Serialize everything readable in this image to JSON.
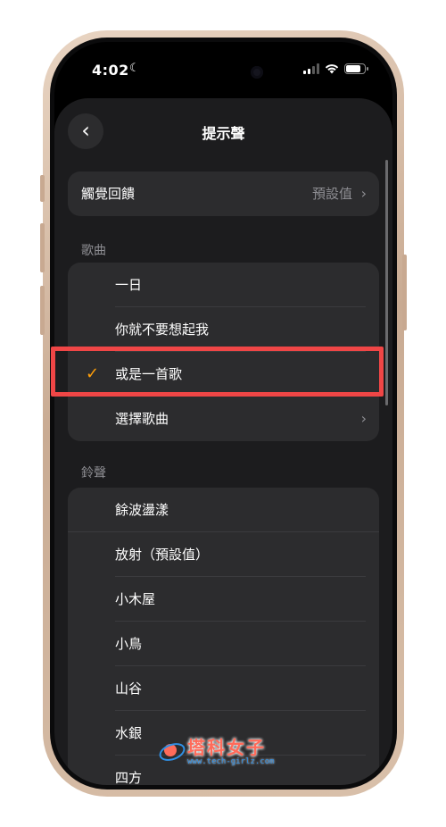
{
  "status": {
    "time": "4:02",
    "moon": "☾"
  },
  "header": {
    "back_icon": "‹",
    "title": "提示聲"
  },
  "haptics": {
    "label": "觸覺回饋",
    "value": "預設值",
    "chevron": "›"
  },
  "songs": {
    "section_label": "歌曲",
    "items": [
      {
        "label": "一日",
        "selected": false
      },
      {
        "label": "你就不要想起我",
        "selected": false
      },
      {
        "label": "或是一首歌",
        "selected": true
      },
      {
        "label": "選擇歌曲",
        "selected": false
      }
    ],
    "check": "✓",
    "chevron": "›"
  },
  "ringtones": {
    "section_label": "鈴聲",
    "items": [
      "餘波盪漾",
      "放射（預設值）",
      "小木屋",
      "小鳥",
      "山谷",
      "水銀",
      "四方"
    ]
  },
  "watermark": {
    "main": "塔科女子",
    "sub": "www.tech-girlz.com"
  },
  "colors": {
    "accent": "#ff9f0a",
    "highlight": "#f04646",
    "sheet": "#1c1c1e",
    "cell": "#2c2c2e"
  }
}
